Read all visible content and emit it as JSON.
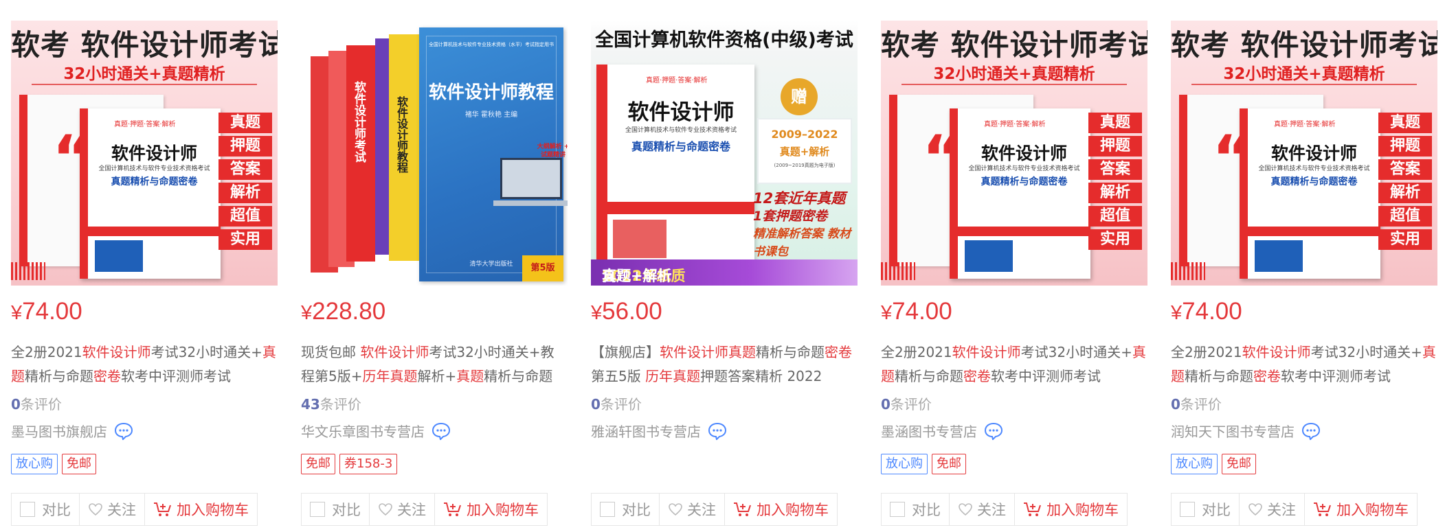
{
  "products": [
    {
      "cover": {
        "headline": "软考 软件设计师考试",
        "subline": "32小时通关+真题精析",
        "book_title": "软件设计师",
        "book_sub": "全国计算机技术与软件专业技术资格考试",
        "book_blue": "真题精析与命题密卷",
        "tag": "真题·押题·答案·解析",
        "features": [
          "真题",
          "押题",
          "答案",
          "解析",
          "超值",
          "实用"
        ]
      },
      "price": {
        "currency": "¥",
        "amount": "74.00"
      },
      "name_parts": [
        {
          "t": "全2册2021",
          "h": false
        },
        {
          "t": "软件设计师",
          "h": true
        },
        {
          "t": "考试32小时通关+",
          "h": false
        },
        {
          "t": "真题",
          "h": true
        },
        {
          "t": "精析与命题",
          "h": false
        },
        {
          "t": "密卷",
          "h": true
        },
        {
          "t": "软考中评测师考试",
          "h": false
        }
      ],
      "comment_count": "0",
      "comment_suffix": "条评价",
      "shop": "墨马图书旗舰店",
      "badges": [
        {
          "text": "放心购",
          "color": "blue"
        },
        {
          "text": "免邮",
          "color": "red"
        }
      ],
      "ops": {
        "compare": "对比",
        "follow": "关注",
        "cart": "加入购物车"
      }
    },
    {
      "cover": {
        "title": "软件设计师教程",
        "series": "全国计算机技术与软件专业技术资格（水平）考试指定用书",
        "authors": "褚华 霍秋艳 主编",
        "publisher": "清华大学出版社",
        "edition": "第5版",
        "sticker": "大纲解析 + 试题精讲",
        "spine_1": "软件设计师考试",
        "spine_2": "软件设计师教程"
      },
      "price": {
        "currency": "¥",
        "amount": "228.80"
      },
      "name_parts": [
        {
          "t": "现货包邮 ",
          "h": false
        },
        {
          "t": "软件设计师",
          "h": true
        },
        {
          "t": "考试32小时通关+教程第5版+",
          "h": false
        },
        {
          "t": "历年真题",
          "h": true
        },
        {
          "t": "解析+",
          "h": false
        },
        {
          "t": "真题",
          "h": true
        },
        {
          "t": "精析与命题",
          "h": false
        }
      ],
      "comment_count": "43",
      "comment_suffix": "条评价",
      "shop": "华文乐章图书专营店",
      "badges": [
        {
          "text": "免邮",
          "color": "red"
        },
        {
          "text": "券158-3",
          "color": "red"
        }
      ],
      "ops": {
        "compare": "对比",
        "follow": "关注",
        "cart": "加入购物车"
      }
    },
    {
      "cover": {
        "headline": "全国计算机软件资格(中级)考试",
        "book_title": "软件设计师",
        "book_sub": "全国计算机技术与软件专业技术资格考试",
        "book_blue": "真题精析与命题密卷",
        "tag": "真题·押题·答案·解析",
        "gift": "赠",
        "gift_years": "2009–2022",
        "gift_desc": "真题+解析",
        "gift_note": "(2009~2019真题为电子版)",
        "note_a": "12套近年真题",
        "note_b": "1套押题密卷",
        "note_c": "精准解析答案 教材书课包",
        "bar_pre": "含",
        "bar_year": "2022年纸质",
        "bar_post": " 真题+解析"
      },
      "price": {
        "currency": "¥",
        "amount": "56.00"
      },
      "name_parts": [
        {
          "t": "【旗舰店】",
          "h": false
        },
        {
          "t": "软件设计师真题",
          "h": true
        },
        {
          "t": "精析与命题",
          "h": false
        },
        {
          "t": "密卷",
          "h": true
        },
        {
          "t": "第五5版 ",
          "h": false
        },
        {
          "t": "历年真题",
          "h": true
        },
        {
          "t": "押题答案精析 2022",
          "h": false
        }
      ],
      "comment_count": "0",
      "comment_suffix": "条评价",
      "shop": "雅涵轩图书专营店",
      "badges": [],
      "ops": {
        "compare": "对比",
        "follow": "关注",
        "cart": "加入购物车"
      }
    },
    {
      "cover": {
        "headline": "软考 软件设计师考试",
        "subline": "32小时通关+真题精析",
        "book_title": "软件设计师",
        "book_sub": "全国计算机技术与软件专业技术资格考试",
        "book_blue": "真题精析与命题密卷",
        "tag": "真题·押题·答案·解析",
        "features": [
          "真题",
          "押题",
          "答案",
          "解析",
          "超值",
          "实用"
        ]
      },
      "price": {
        "currency": "¥",
        "amount": "74.00"
      },
      "name_parts": [
        {
          "t": "全2册2021",
          "h": false
        },
        {
          "t": "软件设计师",
          "h": true
        },
        {
          "t": "考试32小时通关+",
          "h": false
        },
        {
          "t": "真题",
          "h": true
        },
        {
          "t": "精析与命题",
          "h": false
        },
        {
          "t": "密卷",
          "h": true
        },
        {
          "t": "软考中评测师考试",
          "h": false
        }
      ],
      "comment_count": "0",
      "comment_suffix": "条评价",
      "shop": "墨涵图书专营店",
      "badges": [
        {
          "text": "放心购",
          "color": "blue"
        },
        {
          "text": "免邮",
          "color": "red"
        }
      ],
      "ops": {
        "compare": "对比",
        "follow": "关注",
        "cart": "加入购物车"
      }
    },
    {
      "cover": {
        "headline": "软考 软件设计师考试",
        "subline": "32小时通关+真题精析",
        "book_title": "软件设计师",
        "book_sub": "全国计算机技术与软件专业技术资格考试",
        "book_blue": "真题精析与命题密卷",
        "tag": "真题·押题·答案·解析",
        "features": [
          "真题",
          "押题",
          "答案",
          "解析",
          "超值",
          "实用"
        ]
      },
      "price": {
        "currency": "¥",
        "amount": "74.00"
      },
      "name_parts": [
        {
          "t": "全2册2021",
          "h": false
        },
        {
          "t": "软件设计师",
          "h": true
        },
        {
          "t": "考试32小时通关+",
          "h": false
        },
        {
          "t": "真题",
          "h": true
        },
        {
          "t": "精析与命题",
          "h": false
        },
        {
          "t": "密卷",
          "h": true
        },
        {
          "t": "软考中评测师考试",
          "h": false
        }
      ],
      "comment_count": "0",
      "comment_suffix": "条评价",
      "shop": "润知天下图书专营店",
      "badges": [
        {
          "text": "放心购",
          "color": "blue"
        },
        {
          "text": "免邮",
          "color": "red"
        }
      ],
      "ops": {
        "compare": "对比",
        "follow": "关注",
        "cart": "加入购物车"
      }
    }
  ],
  "colors": {
    "price_red": "#e4393c",
    "highlight_red": "#e4393c",
    "badge_blue": "#4d88ff",
    "comment_count_blue": "#646fb0"
  },
  "icons": {
    "chat": "chat-bubble-icon",
    "heart": "heart-icon",
    "cart": "shopping-cart-icon",
    "checkbox": "checkbox"
  }
}
